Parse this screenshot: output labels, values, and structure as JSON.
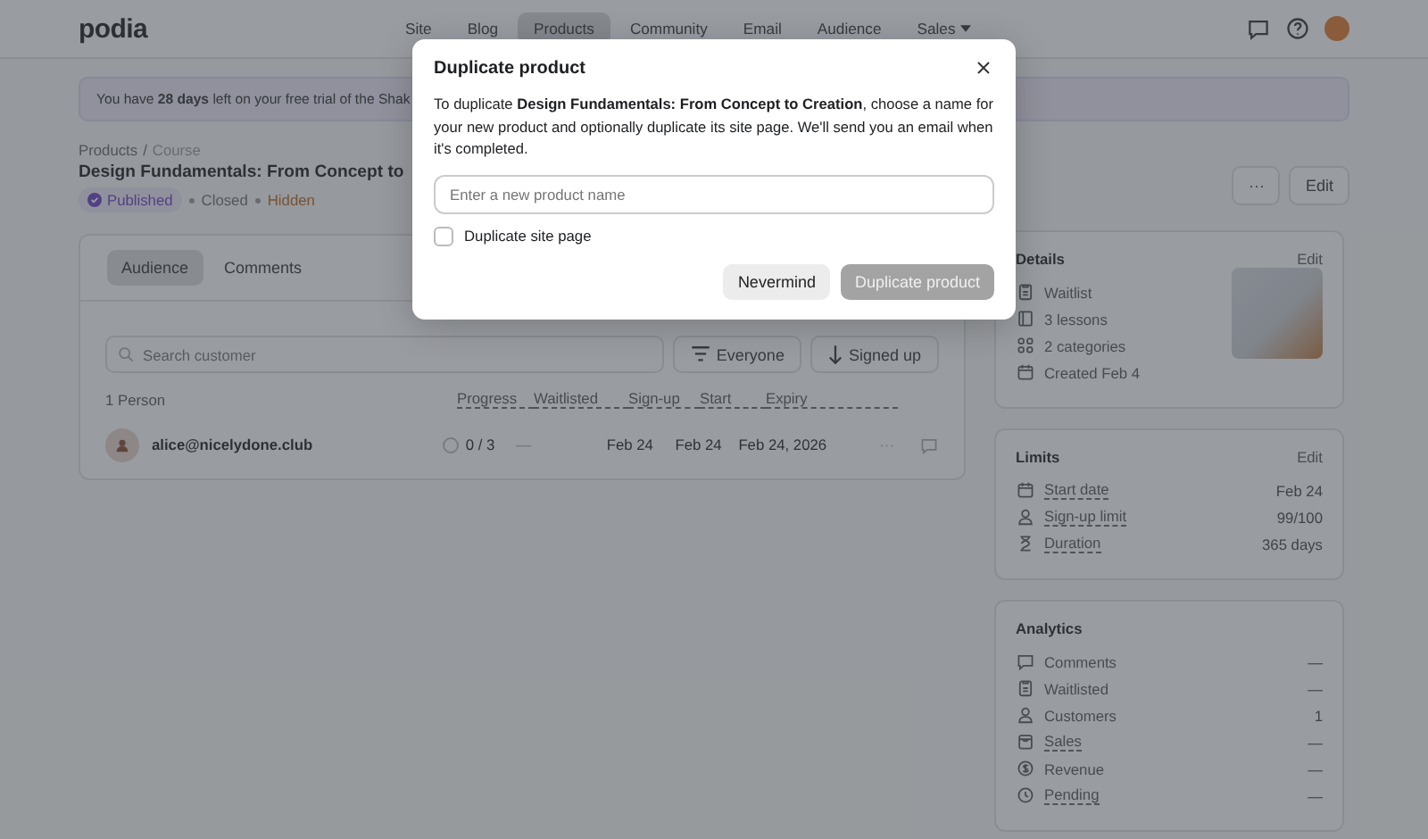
{
  "header": {
    "logo": "podia",
    "nav": [
      {
        "label": "Site",
        "selected": false,
        "dropdown": false
      },
      {
        "label": "Blog",
        "selected": false,
        "dropdown": false
      },
      {
        "label": "Products",
        "selected": true,
        "dropdown": false
      },
      {
        "label": "Community",
        "selected": false,
        "dropdown": false
      },
      {
        "label": "Email",
        "selected": false,
        "dropdown": false
      },
      {
        "label": "Audience",
        "selected": false,
        "dropdown": false
      },
      {
        "label": "Sales",
        "selected": false,
        "dropdown": true
      }
    ]
  },
  "banner": {
    "text": "You have **28 days** left on your free trial of the Shak"
  },
  "breadcrumb": [
    {
      "label": "Products",
      "current": false
    },
    {
      "label": "Course",
      "current": true
    }
  ],
  "breadcrumb_separator": "/",
  "product": {
    "title": "Design Fundamentals: From Concept to",
    "statuses": [
      {
        "label": "Published",
        "kind": "badge"
      },
      {
        "label": "Closed",
        "kind": "plain"
      },
      {
        "label": "Hidden",
        "kind": "warning"
      }
    ],
    "actions": [
      {
        "label": "···"
      },
      {
        "label": "Edit"
      }
    ]
  },
  "audience": {
    "tabs": [
      {
        "label": "Audience",
        "selected": true
      },
      {
        "label": "Comments",
        "selected": false
      }
    ],
    "search": {
      "placeholder": "Search customer"
    },
    "filters": [
      {
        "label": "Everyone",
        "kind": "filter"
      },
      {
        "label": "Signed up",
        "kind": "sort"
      }
    ],
    "count": "1 Person",
    "columns": [
      "Progress",
      "Waitlisted",
      "Sign-up",
      "Start",
      "Expiry"
    ],
    "rows": [
      {
        "email": "alice@nicelydone.club",
        "progress": "0 / 3",
        "waitlisted": "—",
        "signup": "Feb 24",
        "start": "Feb 24",
        "expiry": "Feb 24, 2026",
        "more": "···"
      }
    ]
  },
  "details": {
    "title": "Details",
    "edit": "Edit",
    "items": [
      "Waitlist",
      "3 lessons",
      "2 categories",
      "Created Feb 4"
    ]
  },
  "limits": {
    "title": "Limits",
    "edit": "Edit",
    "items": [
      {
        "label": "Start date",
        "value": "Feb 24",
        "underlined": true
      },
      {
        "label": "Sign-up limit",
        "value": "99/100",
        "underlined": true
      },
      {
        "label": "Duration",
        "value": "365 days",
        "underlined": true
      }
    ]
  },
  "analytics": {
    "title": "Analytics",
    "items": [
      {
        "label": "Comments",
        "value": "—",
        "underlined": false
      },
      {
        "label": "Waitlisted",
        "value": "—",
        "underlined": false
      },
      {
        "label": "Customers",
        "value": "1",
        "underlined": false
      },
      {
        "label": "Sales",
        "value": "—",
        "underlined": true
      },
      {
        "label": "Revenue",
        "value": "—",
        "underlined": false
      },
      {
        "label": "Pending",
        "value": "—",
        "underlined": true
      }
    ]
  },
  "modal": {
    "title": "Duplicate product",
    "body": "To duplicate **Design Fundamentals: From Concept to Creation**, choose a name for your new product and optionally duplicate its site page. We'll send you an email when it's completed.",
    "input": {
      "placeholder": "Enter a new product name"
    },
    "checkbox": {
      "label": "Duplicate site page",
      "checked": false
    },
    "buttons": [
      {
        "label": "Nevermind",
        "kind": "secondary",
        "disabled": false
      },
      {
        "label": "Duplicate product",
        "kind": "primary",
        "disabled": true
      }
    ]
  }
}
